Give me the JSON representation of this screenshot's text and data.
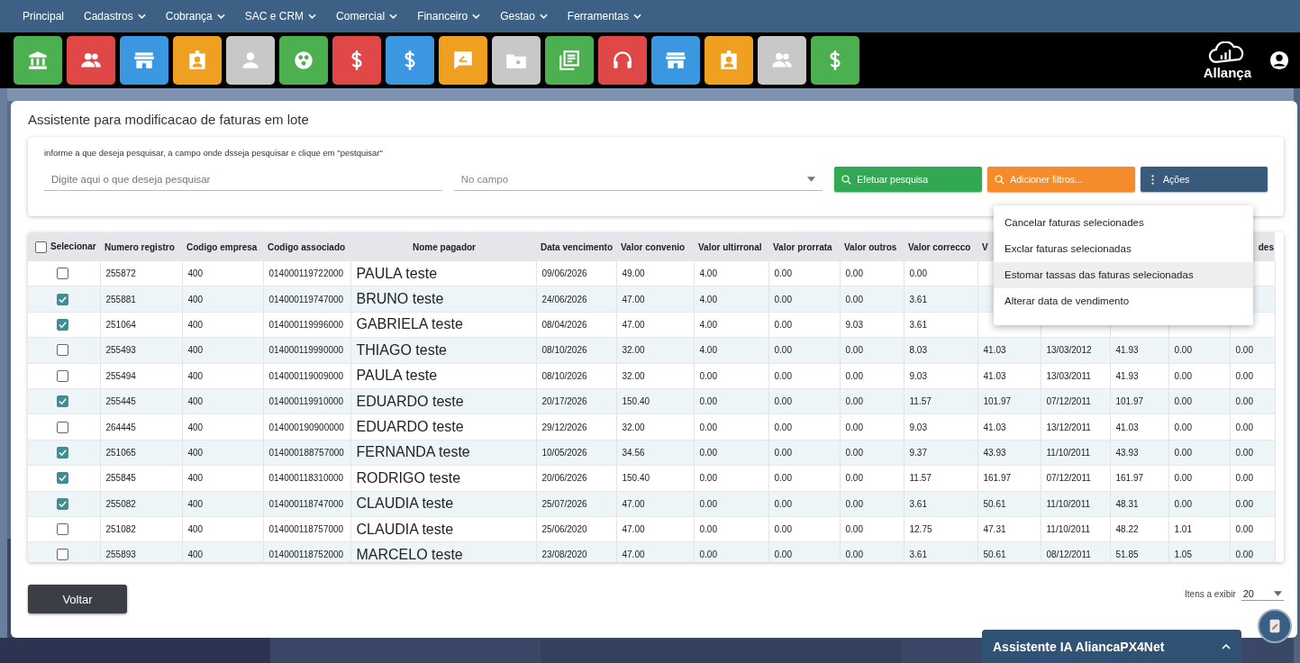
{
  "nav": [
    {
      "label": "Principal",
      "dropdown": false
    },
    {
      "label": "Cadastros",
      "dropdown": true
    },
    {
      "label": "Cobrança",
      "dropdown": true
    },
    {
      "label": "SAC e CRM",
      "dropdown": true
    },
    {
      "label": "Comercial",
      "dropdown": true
    },
    {
      "label": "Financeiro",
      "dropdown": true
    },
    {
      "label": "Gestao",
      "dropdown": true
    },
    {
      "label": "Ferramentas",
      "dropdown": true
    }
  ],
  "shortcuts": [
    {
      "kind": "bank",
      "color": "#4caf50"
    },
    {
      "kind": "group",
      "color": "#e04848"
    },
    {
      "kind": "store",
      "color": "#3a97e0"
    },
    {
      "kind": "badge",
      "color": "#f0a020"
    },
    {
      "kind": "person",
      "color": "#c8c8c8"
    },
    {
      "kind": "dots",
      "color": "#4caf50"
    },
    {
      "kind": "dollar",
      "color": "#e04848"
    },
    {
      "kind": "dollar",
      "color": "#3a97e0"
    },
    {
      "kind": "comment",
      "color": "#f0a020"
    },
    {
      "kind": "folder",
      "color": "#c8c8c8"
    },
    {
      "kind": "list",
      "color": "#4caf50"
    },
    {
      "kind": "headset",
      "color": "#e04848"
    },
    {
      "kind": "store",
      "color": "#3a97e0"
    },
    {
      "kind": "badge",
      "color": "#f0a020"
    },
    {
      "kind": "group",
      "color": "#c8c8c8"
    },
    {
      "kind": "dollar",
      "color": "#4caf50"
    }
  ],
  "logo": {
    "name": "Allança"
  },
  "page_title": "Assistente para modificacao de faturas em lote",
  "search": {
    "instructions": "informe a que deseja pesquisar, a campo onde dsseja pesquisar e clique em \"pestquisar\"",
    "placeholder": "Digite aqui o que deseja pesquisar",
    "field_placeholder": "No campo",
    "search_button": "Efetuar pesquisa",
    "filter_button": "Adicioner filtros...",
    "actions_button": "Ações"
  },
  "actions_menu": {
    "open": true,
    "items": [
      {
        "label": "Cancelar faturas selecionades",
        "selected": false
      },
      {
        "label": "Exclar faturas selecionadas",
        "selected": false
      },
      {
        "label": "Estomar tassas das faturas selecionadas",
        "selected": true
      },
      {
        "label": "Alterar data de vendimento",
        "selected": false
      }
    ]
  },
  "table": {
    "select_all": {
      "label": "Selecionar",
      "checked": false
    },
    "columns": [
      "Numero registro",
      "Codigo empresa",
      "Codigo associado",
      "Nome pagador",
      "Data vencimento",
      "Valor convenio",
      "Valor ultirronal",
      "Valor prorrata",
      "Valor outros",
      "Valor correcco",
      "V",
      null,
      null,
      null,
      "des"
    ],
    "rows": [
      {
        "checked": false,
        "cells": [
          "255872",
          "400",
          "014000119722000",
          "PAULA teste",
          "09/06/2026",
          "49.00",
          "4.00",
          "0.00",
          "0.00",
          "0.00",
          null,
          null,
          null,
          null,
          null
        ]
      },
      {
        "checked": true,
        "cells": [
          "255881",
          "400",
          "014000119747000",
          "BRUNO teste",
          "24/06/2026",
          "47.00",
          "4.00",
          "0.00",
          "0.00",
          "3.61",
          null,
          null,
          null,
          null,
          null
        ]
      },
      {
        "checked": true,
        "cells": [
          "251064",
          "400",
          "014000119996000",
          "GABRIELA teste",
          "08/04/2026",
          "47.00",
          "4.00",
          "0.00",
          "9.03",
          "3.61",
          null,
          null,
          null,
          null,
          null
        ]
      },
      {
        "checked": false,
        "cells": [
          "255493",
          "400",
          "014000119990000",
          "THIAGO teste",
          "08/10/2026",
          "32.00",
          "4.00",
          "0.00",
          "0.00",
          "8.03",
          "41.03",
          "13/03/2012",
          "41.93",
          "0.00",
          "0.00"
        ]
      },
      {
        "checked": false,
        "cells": [
          "255494",
          "400",
          "014000119009000",
          "PAULA teste",
          "08/10/2026",
          "32.00",
          "0.00",
          "0.00",
          "0.00",
          "9.03",
          "41.03",
          "13/03/2011",
          "41.93",
          "0.00",
          "0.00"
        ]
      },
      {
        "checked": true,
        "cells": [
          "255445",
          "400",
          "014000119910000",
          "EDUARDO teste",
          "20/17/2026",
          "150.40",
          "0.00",
          "0.00",
          "0.00",
          "11.57",
          "101.97",
          "07/12/2011",
          "101.97",
          "0.00",
          "0.00"
        ]
      },
      {
        "checked": false,
        "cells": [
          "264445",
          "400",
          "014000190900000",
          "EDUARDO teste",
          "29/12/2026",
          "32.00",
          "0.00",
          "0.00",
          "0.00",
          "9.03",
          "41.03",
          "13/12/2011",
          "41.03",
          "0.00",
          "0.00"
        ]
      },
      {
        "checked": true,
        "cells": [
          "251065",
          "400",
          "014000188757000",
          "FERNANDA teste",
          "10/05/2026",
          "34.56",
          "0.00",
          "0.00",
          "0.00",
          "9.37",
          "43.93",
          "11/10/2011",
          "43.93",
          "0.00",
          "0.00"
        ]
      },
      {
        "checked": true,
        "cells": [
          "255845",
          "400",
          "014000118310000",
          "RODRIGO teste",
          "20/06/2026",
          "150.40",
          "0.00",
          "0.00",
          "0.00",
          "11.57",
          "161.97",
          "07/12/2011",
          "161.97",
          "0.00",
          "0.00"
        ]
      },
      {
        "checked": true,
        "cells": [
          "255082",
          "400",
          "014000118747000",
          "CLAUDIA teste",
          "25/07/2026",
          "47.00",
          "0.00",
          "0.00",
          "0.00",
          "3.61",
          "50.61",
          "11/10/2011",
          "48.31",
          "0.00",
          "0.00"
        ]
      },
      {
        "checked": false,
        "cells": [
          "251082",
          "400",
          "014000118757000",
          "CLAUDIA teste",
          "25/06/2020",
          "47.00",
          "0.00",
          "0.00",
          "0.00",
          "12.75",
          "47.31",
          "11/10/2011",
          "48.22",
          "1.01",
          "0.00"
        ]
      },
      {
        "checked": false,
        "cells": [
          "255893",
          "400",
          "014000118752000",
          "MARCELO teste",
          "23/08/2020",
          "47.00",
          "0.00",
          "0.00",
          "0.00",
          "3.61",
          "50.61",
          "08/12/2011",
          "51.85",
          "1.05",
          "0.00"
        ]
      }
    ]
  },
  "back_button": "Voltar",
  "pagination": {
    "label": "Itens a exibir",
    "value": "20"
  },
  "assistant": {
    "title": "Assistente IA AliancaPX4Net",
    "expanded": false
  }
}
